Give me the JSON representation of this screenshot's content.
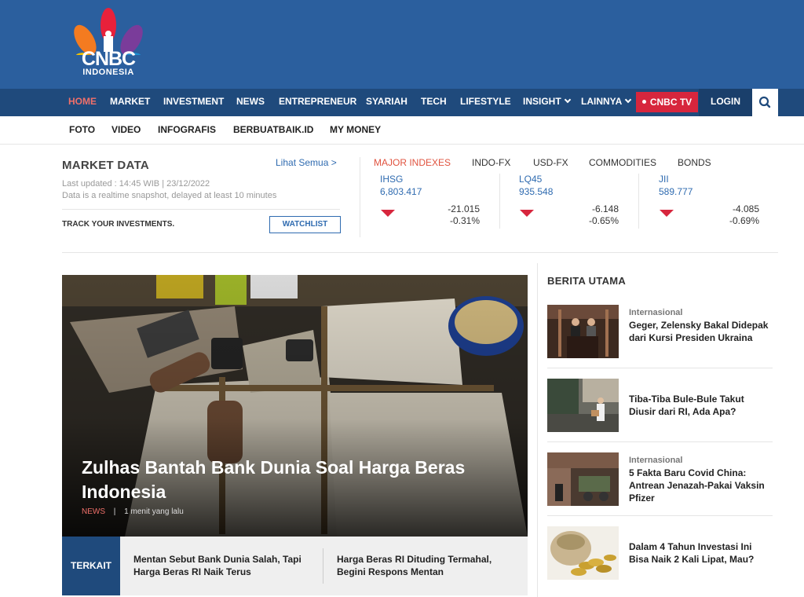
{
  "logo": {
    "text": "CNBC",
    "sub": "INDONESIA"
  },
  "nav": {
    "items": [
      "HOME",
      "MARKET",
      "INVESTMENT",
      "NEWS",
      "ENTREPRENEUR",
      "SYARIAH",
      "TECH",
      "LIFESTYLE"
    ],
    "insight": "INSIGHT",
    "lainnya": "LAINNYA",
    "tv": "CNBC TV",
    "login": "LOGIN"
  },
  "subnav": [
    "FOTO",
    "VIDEO",
    "INFOGRAFIS",
    "BERBUATBAIK.ID",
    "MY MONEY"
  ],
  "market": {
    "title": "MARKET DATA",
    "link": "Lihat Semua >",
    "updated": "Last updated : 14:45 WIB | 23/12/2022",
    "note": "Data is a realtime snapshot, delayed at least 10 minutes",
    "track": "TRACK YOUR INVESTMENTS.",
    "watchlist": "WATCHLIST",
    "tabs": [
      "MAJOR INDEXES",
      "INDO-FX",
      "USD-FX",
      "COMMODITIES",
      "BONDS"
    ],
    "indexes": [
      {
        "name": "IHSG",
        "value": "6,803.417",
        "change": "-21.015",
        "pct": "-0.31%"
      },
      {
        "name": "LQ45",
        "value": "935.548",
        "change": "-6.148",
        "pct": "-0.65%"
      },
      {
        "name": "JII",
        "value": "589.777",
        "change": "-4.085",
        "pct": "-0.69%"
      }
    ]
  },
  "hero": {
    "title": "Zulhas Bantah Bank Dunia Soal Harga Beras Indonesia",
    "category": "NEWS",
    "sep": "|",
    "time": "1 menit yang lalu"
  },
  "related": {
    "label": "TERKAIT",
    "items": [
      "Mentan Sebut Bank Dunia Salah, Tapi Harga Beras RI Naik Terus",
      "Harga Beras RI Dituding Termahal, Begini Respons Mentan"
    ]
  },
  "berita": {
    "title": "BERITA UTAMA",
    "articles": [
      {
        "category": "Internasional",
        "title": "Geger, Zelensky Bakal Didepak dari Kursi Presiden Ukraina"
      },
      {
        "category": "",
        "title": "Tiba-Tiba Bule-Bule Takut Diusir dari RI, Ada Apa?"
      },
      {
        "category": "Internasional",
        "title": "5 Fakta Baru Covid China: Antrean Jenazah-Pakai Vaksin Pfizer"
      },
      {
        "category": "",
        "title": "Dalam 4 Tahun Investasi Ini Bisa Naik 2 Kali Lipat, Mau?"
      }
    ]
  },
  "colors": {
    "header": "#2b5f9e",
    "nav": "#1f4a7c",
    "accent": "#d7263d",
    "link": "#2f6bb0",
    "active": "#f0706a"
  }
}
